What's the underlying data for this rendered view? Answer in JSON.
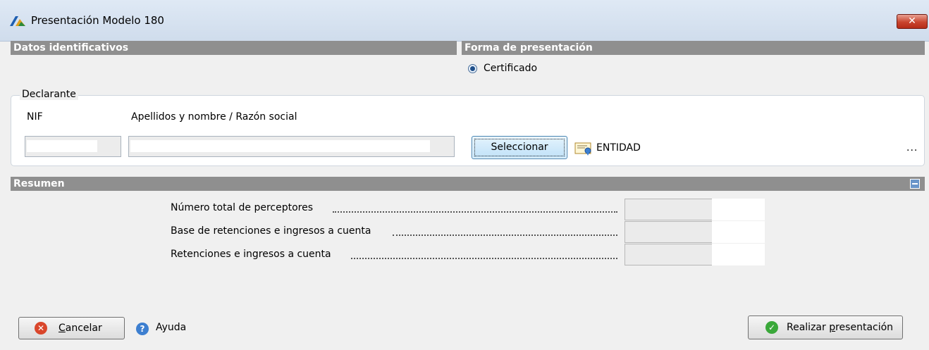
{
  "window": {
    "title": "Presentación Modelo 180",
    "close_glyph": "✕"
  },
  "sections": {
    "datos": "Datos identificativos",
    "forma": "Forma de presentación",
    "resumen": "Resumen"
  },
  "forma": {
    "option_label": "Certificado",
    "selected": true
  },
  "declarante": {
    "legend": "Declarante",
    "nif_label": "NIF",
    "name_label": "Apellidos y nombre / Razón social",
    "nif_value": "",
    "name_value": "",
    "select_button": "Seleccionar",
    "entity_text": "ENTIDAD",
    "more": "..."
  },
  "resumen": {
    "rows": [
      {
        "label": "Número total de perceptores",
        "value": ""
      },
      {
        "label": "Base de retenciones e ingresos a cuenta",
        "value": ""
      },
      {
        "label": "Retenciones e ingresos a cuenta",
        "value": ""
      }
    ]
  },
  "footer": {
    "cancel_first": "C",
    "cancel_rest": "ancelar",
    "help": "Ayuda",
    "submit_pre": "Realizar ",
    "submit_ul": "p",
    "submit_post": "resentación"
  },
  "icons": {
    "app": "aeat-logo-icon",
    "close": "close-icon",
    "cert": "certificate-icon",
    "cancel": "cancel-icon",
    "help": "help-icon",
    "submit": "check-icon",
    "collapse": "collapse-icon"
  },
  "colors": {
    "section_header": "#8f8f8f",
    "titlebar": "#dfe9f5",
    "close_button": "#c9452e",
    "cancel_icon": "#d9462b",
    "help_icon": "#3d7fd0",
    "submit_icon": "#3aa83a"
  }
}
